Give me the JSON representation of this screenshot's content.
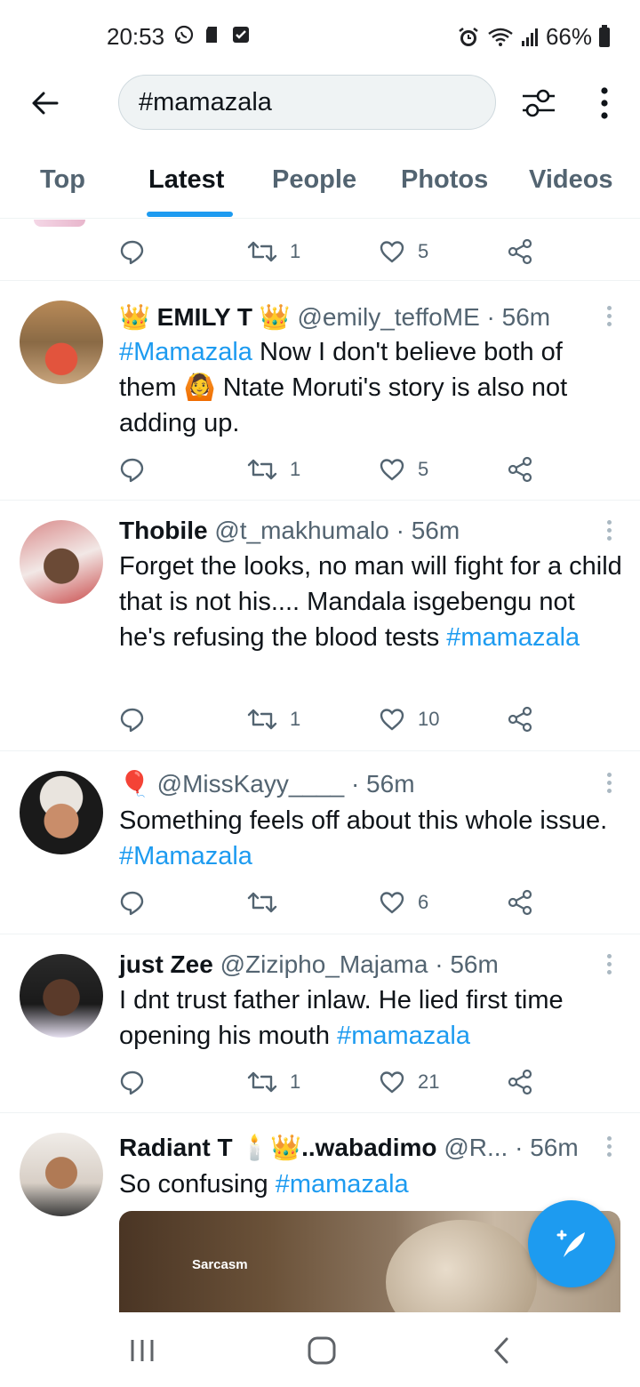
{
  "status_bar": {
    "time": "20:53",
    "battery": "66%"
  },
  "search": {
    "query": "#mamazala"
  },
  "tabs": [
    {
      "label": "Top"
    },
    {
      "label": "Latest"
    },
    {
      "label": "People"
    },
    {
      "label": "Photos"
    },
    {
      "label": "Videos"
    }
  ],
  "partial_tweet": {
    "retweets": "1",
    "likes": "5"
  },
  "tweets": [
    {
      "name": "👑 EMILY T 👑",
      "handle": "@emily_teffoME",
      "time": "· 56m",
      "text_hashtag": "#Mamazala",
      "text": " Now I don't believe both of them 🙆 Ntate Moruti's story is also not adding up.",
      "retweets": "1",
      "likes": "5"
    },
    {
      "name": "Thobile",
      "handle": "@t_makhumalo",
      "time": "· 56m",
      "text": "Forget the looks, no man will fight for a child that is not his.... Mandala isgebengu not he's refusing the blood tests ",
      "text_hashtag": "#mamazala",
      "retweets": "1",
      "likes": "10"
    },
    {
      "name": "🎈",
      "handle": "@MissKayy____",
      "time": "· 56m",
      "text": "Something feels off about this whole issue. ",
      "text_hashtag": "#Mamazala",
      "retweets": "",
      "likes": "6"
    },
    {
      "name": "just Zee",
      "handle": "@Zizipho_Majama",
      "time": "· 56m",
      "text": "I dnt trust father inlaw. He lied first time opening his mouth ",
      "text_hashtag": "#mamazala",
      "retweets": "1",
      "likes": "21"
    },
    {
      "name": "Radiant T 🕯️👑..wabadimo",
      "handle": "@R...",
      "time": "· 56m",
      "text": "So confusing ",
      "text_hashtag": "#mamazala",
      "media_caption": "Sarcasm"
    }
  ],
  "colors": {
    "accent": "#1d9bf0",
    "text": "#0f1419",
    "muted": "#536471"
  }
}
